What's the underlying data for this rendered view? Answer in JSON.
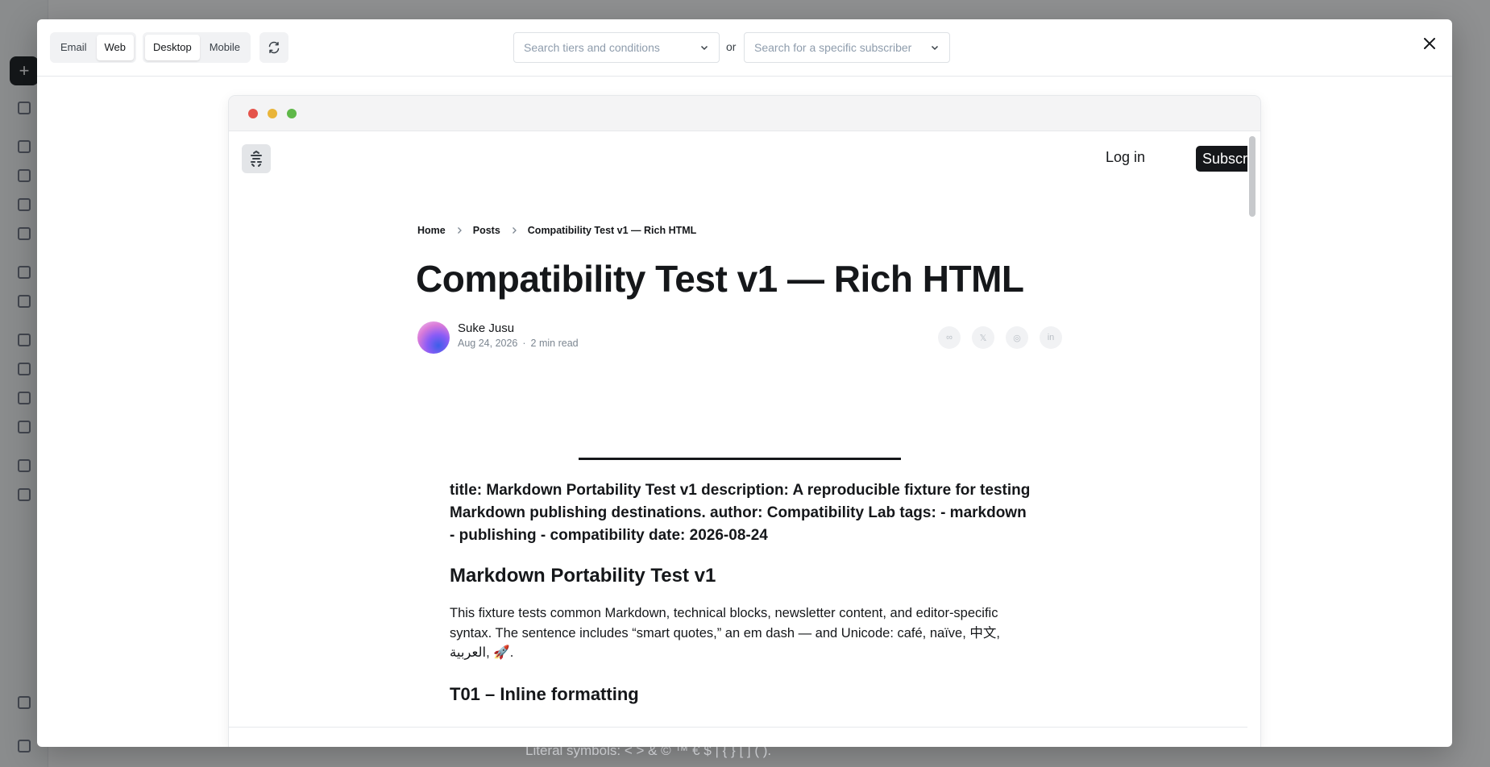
{
  "background": {
    "footer_text": "Literal symbols: < > & © ™ € $ | { } [ ] ( )."
  },
  "header": {
    "channel_tabs": [
      {
        "label": "Email",
        "active": false
      },
      {
        "label": "Web",
        "active": true
      }
    ],
    "device_tabs": [
      {
        "label": "Desktop",
        "active": true
      },
      {
        "label": "Mobile",
        "active": false
      }
    ],
    "tier_select_placeholder": "Search tiers and conditions",
    "or_label": "or",
    "subscriber_select_placeholder": "Search for a specific subscriber",
    "icons": {
      "refresh": "refresh-icon",
      "close": "close-icon",
      "chevron": "chevron-down-icon"
    }
  },
  "browser": {
    "dot_colors": [
      "#e5534b",
      "#e9b53a",
      "#5fb849"
    ]
  },
  "site": {
    "login_label": "Log in",
    "subscribe_label": "Subscribe"
  },
  "post": {
    "breadcrumb": [
      "Home",
      "Posts",
      "Compatibility Test v1 — Rich HTML"
    ],
    "title": "Compatibility Test v1 — Rich HTML",
    "author": "Suke Jusu",
    "date": "Aug 24, 2026",
    "read_time": "2 min read",
    "share_icons": [
      "∞",
      "𝕏",
      "◎",
      "in"
    ],
    "frontmatter": "title: Markdown Portability Test v1 description: A reproducible fixture for testing Markdown publishing destinations. author: Compatibility Lab tags: - markdown - publishing - compatibility date: 2026-08-24",
    "heading": "Markdown Portability Test v1",
    "paragraph": "This fixture tests common Markdown, technical blocks, newsletter content, and editor-specific syntax. The sentence includes “smart quotes,” an em dash — and Unicode: café, naïve, 中文, العربية, 🚀.",
    "next_heading": "T01 – Inline formatting"
  },
  "colors": {
    "accent": "#15171a",
    "muted": "#7c8691"
  }
}
